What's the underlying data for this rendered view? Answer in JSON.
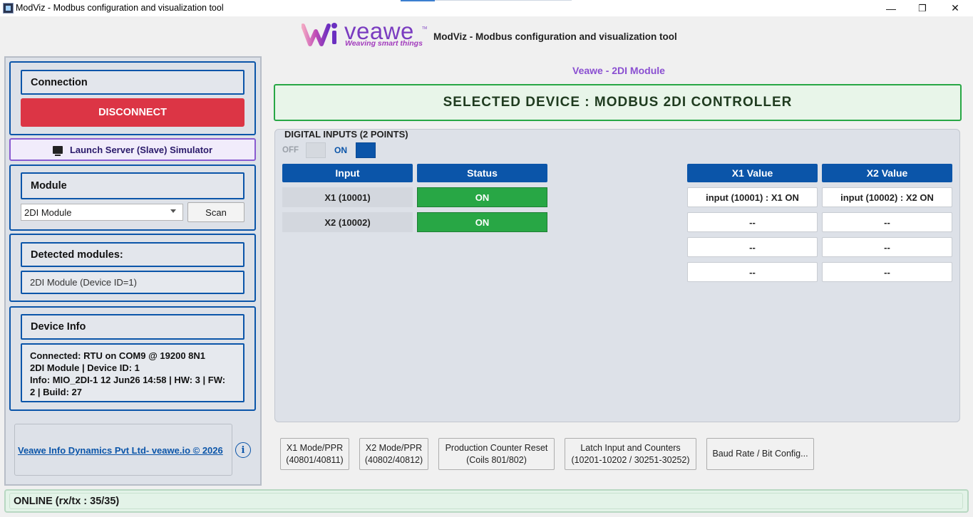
{
  "window": {
    "title": "ModViz - Modbus configuration and visualization tool",
    "minimize": "—",
    "maximize": "❐",
    "close": "✕"
  },
  "header": {
    "logo_text": "veawe",
    "logo_tm": "TM",
    "tagline": "Weaving smart things",
    "title": "ModViz - Modbus configuration and visualization tool"
  },
  "connection": {
    "header": "Connection",
    "disconnect_label": "DISCONNECT"
  },
  "simulator": {
    "label": "Launch Server (Slave) Simulator"
  },
  "module": {
    "header": "Module",
    "selected": "2DI Module",
    "scan_label": "Scan"
  },
  "detected": {
    "header": "Detected modules:",
    "items": [
      "2DI Module (Device ID=1)"
    ]
  },
  "device_info": {
    "header": "Device Info",
    "line1": "Connected: RTU on COM9 @ 19200 8N1",
    "line2": "2DI Module | Device ID: 1",
    "line3": "Info: MIO_2DI-1  12 Jun26 14:58 | HW: 3 | FW:",
    "line4": "2 | Build: 27"
  },
  "footer": {
    "link": "Veawe Info Dynamics Pvt Ltd- veawe.io © 2026",
    "info_icon": "i"
  },
  "main": {
    "module_caption": "Veawe - 2DI Module",
    "selected_device": "SELECTED DEVICE : MODBUS 2DI CONTROLLER",
    "io_title": "DIGITAL INPUTS (2 POINTS)",
    "legend_off": "OFF",
    "legend_on": "ON",
    "table": {
      "col_input": "Input",
      "col_status": "Status",
      "rows": [
        {
          "input": "X1 (10001)",
          "status": "ON"
        },
        {
          "input": "X2 (10002)",
          "status": "ON"
        }
      ]
    },
    "values": {
      "col_x1": "X1 Value",
      "col_x2": "X2 Value",
      "x1": [
        "input (10001) : X1 ON",
        "--",
        "--",
        "--"
      ],
      "x2": [
        "input (10002) : X2 ON",
        "--",
        "--",
        "--"
      ]
    }
  },
  "bottom_buttons": [
    {
      "line1": "X1 Mode/PPR",
      "line2": "(40801/40811)"
    },
    {
      "line1": "X2 Mode/PPR",
      "line2": "(40802/40812)"
    },
    {
      "line1": "Production Counter Reset",
      "line2": "(Coils 801/802)"
    },
    {
      "line1": "Latch Input and Counters",
      "line2": "(10201-10202 / 30251-30252)"
    },
    {
      "line1": "Baud Rate / Bit Config..."
    }
  ],
  "status_bar": {
    "text": "ONLINE (rx/tx : 35/35)"
  },
  "colors": {
    "accent_blue": "#0b55a9",
    "disconnect_red": "#dc3545",
    "status_green": "#28a745",
    "brand_purple": "#7a3cc0"
  }
}
